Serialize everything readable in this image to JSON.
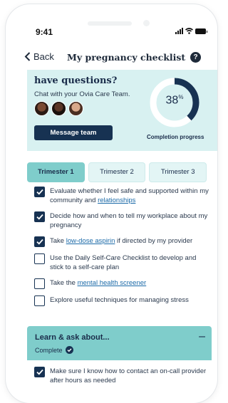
{
  "status_bar": {
    "time": "9:41"
  },
  "nav": {
    "back_label": "Back",
    "title": "My pregnancy checklist",
    "help_icon": "?"
  },
  "hero": {
    "title": "have questions?",
    "subtitle": "Chat with your Ovia Care Team.",
    "button_label": "Message team",
    "progress_value": "38",
    "progress_unit": "%",
    "progress_fraction": 0.38,
    "progress_label": "Completion progress"
  },
  "tabs": [
    {
      "label": "Trimester 1",
      "active": true
    },
    {
      "label": "Trimester 2",
      "active": false
    },
    {
      "label": "Trimester 3",
      "active": false
    }
  ],
  "checklist": [
    {
      "checked": true,
      "text": "Evaluate whether I feel safe and supported within my community and ",
      "link": "relationships",
      "after": ""
    },
    {
      "checked": true,
      "text": "Decide how and when to tell my workplace about my pregnancy",
      "link": "",
      "after": ""
    },
    {
      "checked": true,
      "text": "Take ",
      "link": "low-dose aspirin",
      "after": " if directed by my provider"
    },
    {
      "checked": false,
      "text": "Use the Daily Self-Care Checklist to develop and stick to a self-care plan",
      "link": "",
      "after": ""
    },
    {
      "checked": false,
      "text": "Take the ",
      "link": "mental health screener",
      "after": ""
    },
    {
      "checked": false,
      "text": "Explore useful techniques for managing stress",
      "link": "",
      "after": ""
    }
  ],
  "learn": {
    "title": "Learn & ask about...",
    "status": "Complete",
    "collapse_icon": "–"
  },
  "learn_items": [
    {
      "checked": true,
      "text": "Make sure I know how to contact an on-call provider after hours as needed"
    }
  ],
  "colors": {
    "navy": "#173252",
    "teal": "#7fcdcb",
    "mint": "#d8f1f1",
    "link": "#1b6aa8"
  }
}
